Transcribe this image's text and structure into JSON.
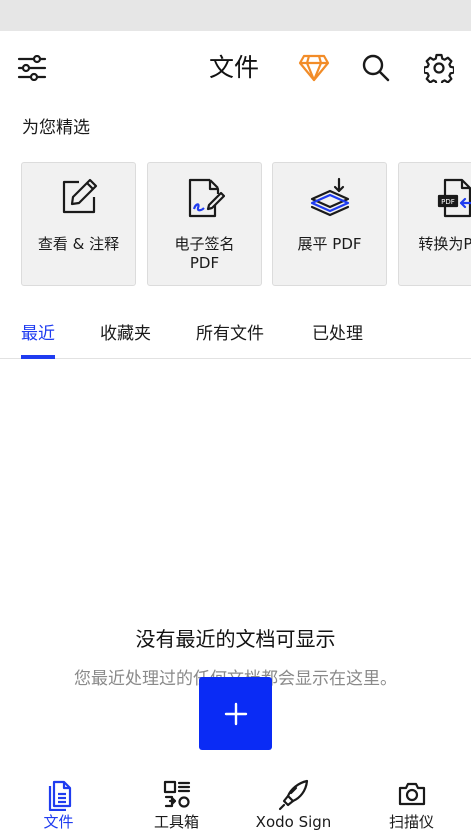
{
  "app_bar": {
    "title": "文件",
    "icons": [
      "filter-sliders-icon",
      "premium-diamond-icon",
      "search-icon",
      "settings-gear-icon"
    ]
  },
  "featured": {
    "title": "为您精选",
    "cards": [
      {
        "label": "查看 & 注释",
        "icon": "edit-annotate-icon"
      },
      {
        "label": "电子签名\nPDF",
        "icon": "sign-document-icon"
      },
      {
        "label": "展平 PDF",
        "icon": "flatten-layers-icon"
      },
      {
        "label": "转换为PDF",
        "icon": "convert-pdf-icon"
      }
    ]
  },
  "tabs": [
    {
      "label": "最近",
      "active": true
    },
    {
      "label": "收藏夹",
      "active": false
    },
    {
      "label": "所有文件",
      "active": false
    },
    {
      "label": "已处理",
      "active": false
    }
  ],
  "empty_state": {
    "title": "没有最近的文档可显示",
    "subtitle": "您最近处理过的任何文档都会显示在这里。"
  },
  "bottom_nav": [
    {
      "label": "文件",
      "icon": "files-icon",
      "active": true
    },
    {
      "label": "工具箱",
      "icon": "toolbox-icon",
      "active": false
    },
    {
      "label": "Xodo Sign",
      "icon": "pen-nib-icon",
      "active": false
    },
    {
      "label": "扫描仪",
      "icon": "camera-icon",
      "active": false
    }
  ],
  "colors": {
    "accent": "#1f3cf0",
    "fab": "#0a2bf5",
    "premium": "#f28c28",
    "card_bg": "#f1f1f1"
  }
}
